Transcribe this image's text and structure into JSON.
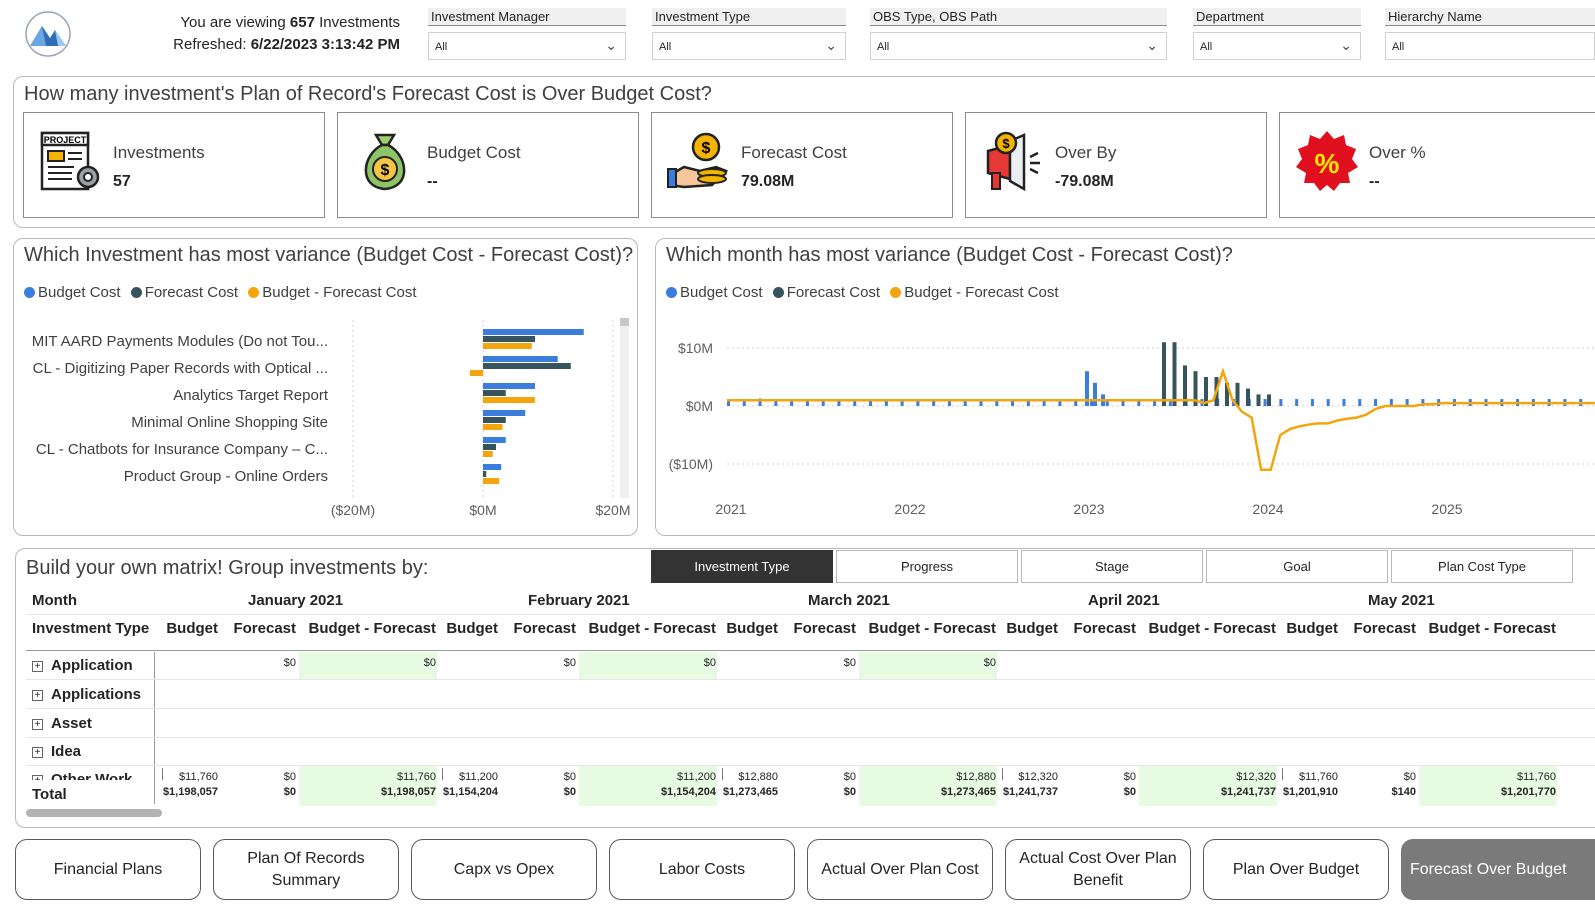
{
  "header": {
    "viewing_prefix": "You are viewing",
    "count": "657",
    "viewing_suffix": "Investments",
    "refreshed_label": "Refreshed:",
    "refreshed_value": "6/22/2023 3:13:42 PM"
  },
  "slicers": [
    {
      "label": "Investment Manager",
      "value": "All"
    },
    {
      "label": "Investment Type",
      "value": "All"
    },
    {
      "label": "OBS Type, OBS Path",
      "value": "All"
    },
    {
      "label": "Department",
      "value": "All"
    },
    {
      "label": "Hierarchy Name",
      "value": "All"
    }
  ],
  "kpi": {
    "title": "How many investment's Plan of Record's Forecast Cost is Over Budget Cost?",
    "cards": [
      {
        "label": "Investments",
        "value": "57",
        "icon": "project-document-icon"
      },
      {
        "label": "Budget Cost",
        "value": "--",
        "icon": "money-bag-icon"
      },
      {
        "label": "Forecast Cost",
        "value": "79.08M",
        "icon": "coins-hand-icon"
      },
      {
        "label": "Over By",
        "value": "-79.08M",
        "icon": "megaphone-dollar-icon"
      },
      {
        "label": "Over %",
        "value": "--",
        "icon": "percent-badge-icon"
      }
    ]
  },
  "colors": {
    "budget": "#3b7ddd",
    "forecast": "#37535e",
    "diff": "#f2a50c",
    "matrix_green": "#e6fbe2"
  },
  "legend": [
    "Budget Cost",
    "Forecast Cost",
    "Budget - Forecast Cost"
  ],
  "bar_chart_title": "Which Investment has most variance (Budget Cost - Forecast Cost)?",
  "line_chart_title": "Which month has most variance (Budget Cost - Forecast Cost)?",
  "chart_data": [
    {
      "type": "bar",
      "orientation": "horizontal",
      "title": "Which Investment has most variance (Budget Cost - Forecast Cost)?",
      "categories": [
        "MIT AARD Payments Modules (Do not Tou...",
        "CL - Digitizing Paper Records with Optical ...",
        "Analytics Target Report",
        "Minimal Online Shopping Site",
        "CL - Chatbots for Insurance Company – C...",
        "Product Group - Online Orders"
      ],
      "series": [
        {
          "name": "Budget Cost",
          "values": [
            15.5,
            11.5,
            8.0,
            6.5,
            3.5,
            2.8
          ]
        },
        {
          "name": "Forecast Cost",
          "values": [
            8.0,
            13.5,
            3.5,
            3.5,
            2.0,
            0.5
          ]
        },
        {
          "name": "Budget - Forecast Cost",
          "values": [
            7.5,
            -2.0,
            8.0,
            3.0,
            1.5,
            2.5
          ]
        }
      ],
      "xticks": [
        "($20M)",
        "$0M",
        "$20M"
      ],
      "xlim": [
        -20,
        20
      ],
      "legend": "top-left",
      "grid": true
    },
    {
      "type": "line",
      "title": "Which month has most variance (Budget Cost - Forecast Cost)?",
      "x_ticks": [
        "2021",
        "2022",
        "2023",
        "2024",
        "2025"
      ],
      "y_ticks": [
        "$10M",
        "$0M",
        "($10M)"
      ],
      "ylim": [
        -12,
        12
      ],
      "legend": "top-left",
      "grid": true,
      "series": [
        {
          "name": "Budget Cost",
          "values": [
            1.2,
            1.2,
            1.3,
            1.2,
            1.2,
            1.2,
            1.2,
            1.2,
            1.2,
            1.2,
            1.2,
            1.2,
            1.2,
            1.2,
            1.2,
            1.2,
            1.2,
            1.2,
            1.2,
            1.2,
            1.2,
            1.2,
            1.2,
            1.2,
            1.2,
            1.2,
            1.2,
            1.2,
            1.2,
            1.2,
            1.2,
            1.2,
            1.2,
            1.2,
            1.2,
            1.2,
            1.2,
            1.2,
            1.2,
            1.2,
            1.2,
            1.2,
            1.2,
            1.2,
            1.2,
            1.2,
            1.2,
            1.2,
            1.2,
            1.2,
            1.2,
            1.2,
            1.2,
            1.2,
            1.2,
            1.2
          ]
        },
        {
          "name": "Forecast Cost",
          "values": [
            0.1,
            0.1,
            0.1,
            0.1,
            0.1,
            0.1,
            0.1,
            0.1,
            0.1,
            0.1,
            0.1,
            0.1,
            0.1,
            0.1,
            0.1,
            0.1,
            0.1,
            0.1,
            0.1,
            0.1,
            0.1,
            0.1,
            0.1,
            0.1,
            0.1,
            0.1,
            0.1,
            0.1,
            0.1,
            0.1,
            0.1,
            0.1,
            0.1,
            0.1,
            0.1,
            0.1,
            0.1,
            0.1,
            0.1,
            0.1,
            0.1,
            0.1,
            0.1,
            0.1,
            0.1,
            0.1,
            0.1,
            0.1,
            0.1,
            0.1,
            0.1,
            0.1,
            0.1,
            0.1,
            0.1,
            0.1
          ]
        },
        {
          "name": "Budget - Forecast Cost",
          "values": [
            1.1,
            1.1,
            1.2,
            1.1,
            1.1,
            1.1,
            1.1,
            1.1,
            1.1,
            1.1,
            1.1,
            1.1,
            1.1,
            1.1,
            1.1,
            1.1,
            1.1,
            1.1,
            1.1,
            1.1,
            1.1,
            1.1,
            1.1,
            1.1,
            1.1,
            1.1,
            1.1,
            1.1,
            1.1,
            1.1,
            1.1,
            1.1,
            1.1,
            1.1,
            1.1,
            1.1,
            1.1,
            1.1,
            1.1,
            1.1,
            1.1,
            1.1,
            1.1,
            1.1,
            1.1,
            1.1,
            1.1,
            1.1,
            1.1,
            1.1,
            1.1,
            1.1,
            1.1,
            1.1,
            1.1,
            1.1
          ]
        }
      ],
      "spikes": {
        "budget_2023": [
          6,
          4,
          2
        ],
        "forecast_2023_2024": [
          11,
          11,
          7,
          6,
          5,
          5,
          4,
          4,
          3,
          2,
          2
        ]
      },
      "diff_line": [
        1,
        1,
        1,
        1,
        1,
        1,
        1,
        1,
        1,
        1,
        1,
        1,
        1,
        1,
        1,
        1,
        1,
        1,
        1,
        1,
        1,
        1,
        1,
        1,
        1,
        1,
        1,
        1,
        1,
        1,
        1,
        1,
        1,
        1,
        1,
        1,
        1,
        1,
        1,
        1,
        1,
        1,
        1,
        1,
        1,
        1,
        1,
        1,
        1,
        1,
        0.5,
        1,
        6,
        1,
        -1,
        -2,
        -11,
        -11,
        -5,
        -4,
        -3.5,
        -3.2,
        -3,
        -3,
        -2.5,
        -2.2,
        -2,
        -1.5,
        -0.5,
        0,
        0,
        0,
        0,
        0.3,
        0.3,
        0.5,
        0.5,
        0.5,
        0.5,
        0.5,
        0.5,
        0.5,
        0.5,
        0.5,
        0.5,
        0.5,
        0.5,
        0.5,
        0.5,
        0.5,
        0.5,
        0.5
      ]
    }
  ],
  "matrix": {
    "title": "Build your own matrix! Group investments by:",
    "tabs": [
      "Investment Type",
      "Progress",
      "Stage",
      "Goal",
      "Plan Cost Type"
    ],
    "active_tab": "Investment Type",
    "row_header_1": "Month",
    "row_header_2": "Investment Type",
    "months": [
      "January 2021",
      "February 2021",
      "March 2021",
      "April 2021",
      "May 2021"
    ],
    "col_labels": [
      "Budget",
      "Forecast",
      "Budget - Forecast"
    ],
    "rows": [
      "Application",
      "Applications",
      "Asset",
      "Idea",
      "Other Work"
    ],
    "total_label": "Total",
    "application_values": [
      "$0",
      "$0",
      "$0",
      "$0",
      "$0",
      "$0"
    ],
    "other_work": [
      [
        "$11,760",
        "$0",
        "$11,760"
      ],
      [
        "$11,200",
        "$0",
        "$11,200"
      ],
      [
        "$12,880",
        "$0",
        "$12,880"
      ],
      [
        "$12,320",
        "$0",
        "$12,320"
      ],
      [
        "$11,760",
        "$0",
        "$11,760"
      ]
    ],
    "totals": [
      [
        "$1,198,057",
        "$0",
        "$1,198,057"
      ],
      [
        "$1,154,204",
        "$0",
        "$1,154,204"
      ],
      [
        "$1,273,465",
        "$0",
        "$1,273,465"
      ],
      [
        "$1,241,737",
        "$0",
        "$1,241,737"
      ],
      [
        "$1,201,910",
        "$140",
        "$1,201,770"
      ]
    ]
  },
  "nav_buttons": [
    "Financial Plans",
    "Plan Of Records Summary",
    "Capx vs Opex",
    "Labor Costs",
    "Actual Over Plan Cost",
    "Actual Cost Over Plan Benefit",
    "Plan Over Budget",
    "Forecast Over Budget"
  ],
  "nav_active": "Forecast Over Budget"
}
